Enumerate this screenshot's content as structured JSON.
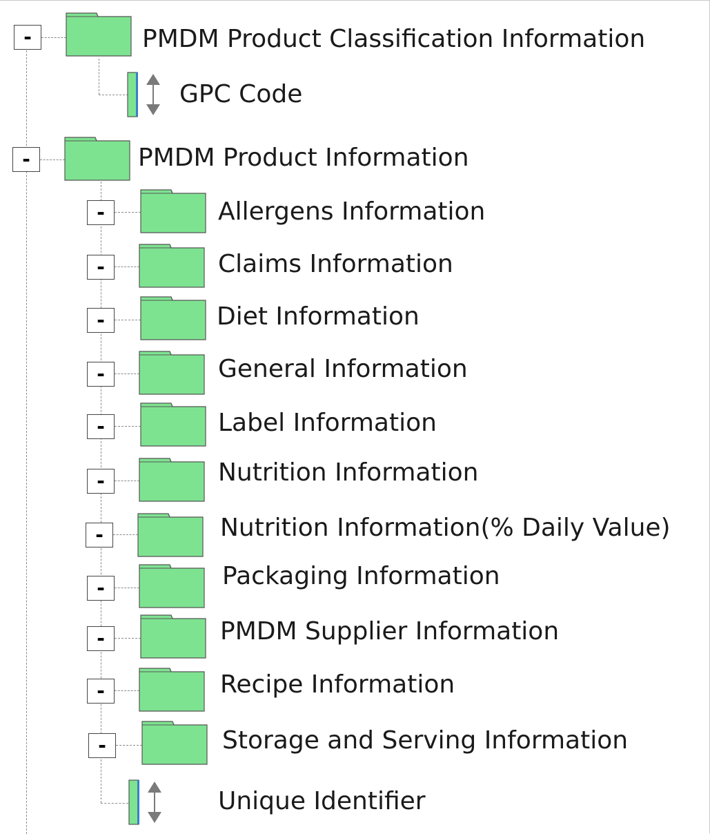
{
  "tree": {
    "root_nodes": [
      {
        "label": "PMDM Product Classification Information",
        "toggle": "-",
        "icon": "folder-icon",
        "children": [
          {
            "label": "GPC Code",
            "icon": "attribute-icon"
          }
        ]
      },
      {
        "label": "PMDM Product Information",
        "toggle": "-",
        "icon": "folder-icon",
        "children": [
          {
            "label": "Allergens Information",
            "toggle": "-",
            "icon": "folder-icon"
          },
          {
            "label": "Claims Information",
            "toggle": "-",
            "icon": "folder-icon"
          },
          {
            "label": "Diet Information",
            "toggle": "-",
            "icon": "folder-icon"
          },
          {
            "label": "General Information",
            "toggle": "-",
            "icon": "folder-icon"
          },
          {
            "label": "Label Information",
            "toggle": "-",
            "icon": "folder-icon"
          },
          {
            "label": "Nutrition Information",
            "toggle": "-",
            "icon": "folder-icon"
          },
          {
            "label": "Nutrition Information(% Daily Value)",
            "toggle": "-",
            "icon": "folder-icon"
          },
          {
            "label": "Packaging Information",
            "toggle": "-",
            "icon": "folder-icon"
          },
          {
            "label": "PMDM Supplier Information",
            "toggle": "-",
            "icon": "folder-icon"
          },
          {
            "label": "Recipe Information",
            "toggle": "-",
            "icon": "folder-icon"
          },
          {
            "label": "Storage and Serving Information",
            "toggle": "-",
            "icon": "folder-icon"
          },
          {
            "label": "Unique Identifier",
            "icon": "attribute-icon"
          }
        ]
      }
    ]
  },
  "colors": {
    "folder_fill": "#7ee391",
    "folder_stroke": "#555555",
    "attr_fill": "#7ee391",
    "attr_bar": "#3a7ec9",
    "arrow": "#7a7a7a",
    "connector": "#8a8a8a"
  }
}
